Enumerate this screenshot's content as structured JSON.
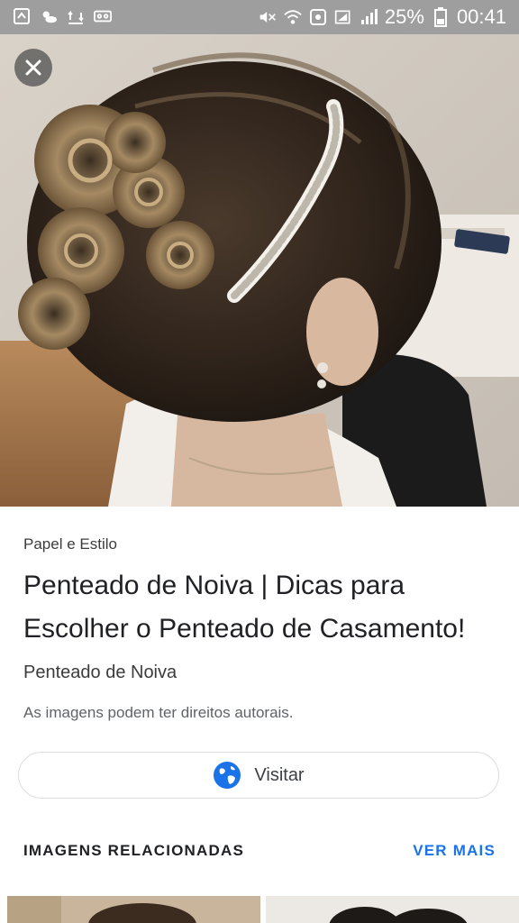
{
  "status_bar": {
    "battery_percent": "25%",
    "time": "00:41",
    "left_icons": [
      "drive-upload-icon",
      "weather-icon",
      "sync-icon",
      "voicemail-icon"
    ],
    "right_icons": [
      "mute-icon",
      "wifi-icon",
      "data-saver-icon",
      "signal-icon",
      "battery-icon"
    ]
  },
  "hero": {
    "close_icon": "close-icon"
  },
  "result": {
    "source": "Papel e Estilo",
    "title": "Penteado de Noiva | Dicas para Escolher o Penteado de Casamento!",
    "subtitle": "Penteado de Noiva",
    "copyright": "As imagens podem ter direitos autorais.",
    "visit_label": "Visitar",
    "visit_icon": "globe-icon"
  },
  "related": {
    "heading": "IMAGENS RELACIONADAS",
    "see_more": "VER MAIS"
  },
  "colors": {
    "status_bar": "#9e9e9e",
    "accent": "#1a73e8",
    "text_primary": "#202124"
  }
}
